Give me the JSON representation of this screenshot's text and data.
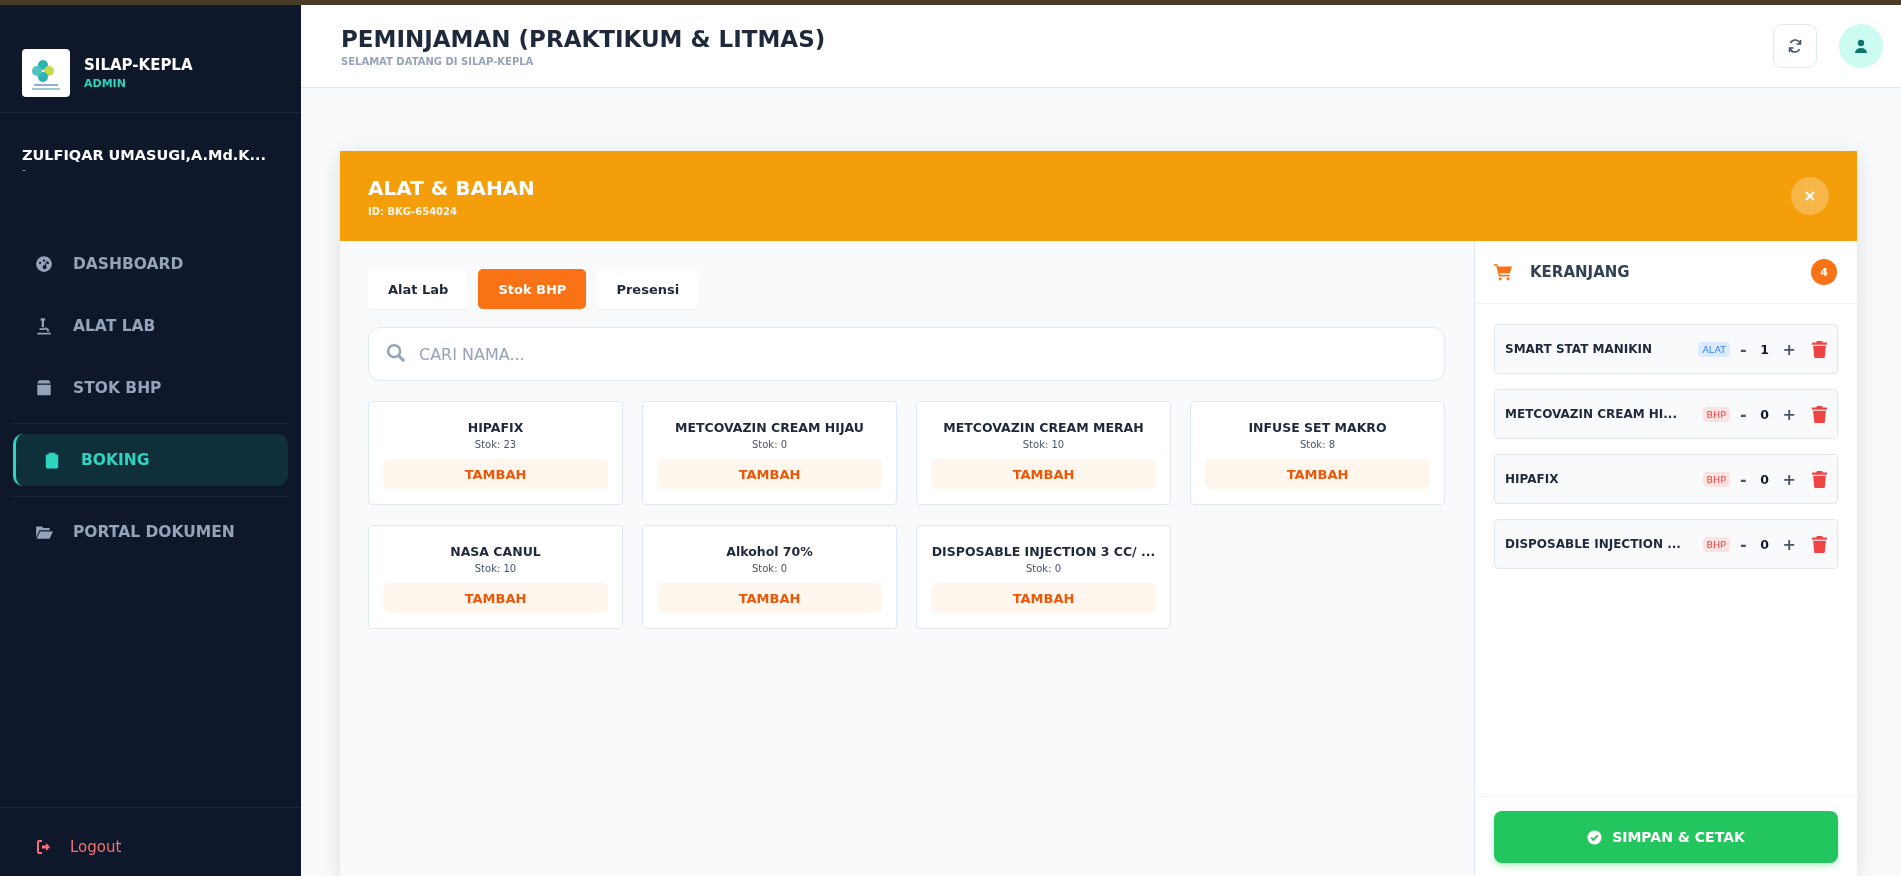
{
  "sidebar": {
    "app_name": "SILAP-KEPLA",
    "role": "ADMIN",
    "user_name": "ZULFIQAR UMASUGI,A.Md.K...",
    "user_sub": "-",
    "items": [
      {
        "label": "DASHBOARD",
        "selected": false
      },
      {
        "label": "ALAT LAB",
        "selected": false
      },
      {
        "label": "STOK BHP",
        "selected": false
      },
      {
        "label": "BOKING",
        "selected": true
      },
      {
        "label": "PORTAL DOKUMEN",
        "selected": false
      }
    ],
    "logout": "Logout"
  },
  "header": {
    "title": "PEMINJAMAN (PRAKTIKUM & LITMAS)",
    "subtitle": "SELAMAT DATANG DI SILAP-KEPLA"
  },
  "modal": {
    "title": "ALAT & BAHAN",
    "id": "ID: BKG-654024",
    "categories": [
      {
        "label": "Alat Lab",
        "selected": false
      },
      {
        "label": "Stok BHP",
        "selected": true
      },
      {
        "label": "Presensi",
        "selected": false
      }
    ],
    "search": {
      "placeholder": "CARI NAMA..."
    },
    "products": [
      {
        "name": "HIPAFIX",
        "stock": "Stok: 23",
        "action": "TAMBAH"
      },
      {
        "name": "METCOVAZIN CREAM HIJAU",
        "stock": "Stok: 0",
        "action": "TAMBAH"
      },
      {
        "name": "METCOVAZIN CREAM MERAH",
        "stock": "Stok: 10",
        "action": "TAMBAH"
      },
      {
        "name": "INFUSE SET MAKRO",
        "stock": "Stok: 8",
        "action": "TAMBAH"
      },
      {
        "name": "NASA CANUL",
        "stock": "Stok: 10",
        "action": "TAMBAH"
      },
      {
        "name": "Alkohol 70%",
        "stock": "Stok: 0",
        "action": "TAMBAH"
      },
      {
        "name": "DISPOSABLE INJECTION 3 CC/ ...",
        "stock": "Stok: 0",
        "action": "TAMBAH"
      }
    ],
    "cart": {
      "title": "KERANJANG",
      "count": "4",
      "items": [
        {
          "name": "SMART STAT MANIKIN",
          "tag": "ALAT",
          "kind": "alat",
          "qty": "1",
          "minus": "-",
          "plus": "+"
        },
        {
          "name": "METCOVAZIN CREAM HI...",
          "tag": "BHP",
          "kind": "bhp",
          "qty": "0",
          "minus": "-",
          "plus": "+"
        },
        {
          "name": "HIPAFIX",
          "tag": "BHP",
          "kind": "bhp",
          "qty": "0",
          "minus": "-",
          "plus": "+"
        },
        {
          "name": "DISPOSABLE INJECTION ...",
          "tag": "BHP",
          "kind": "bhp",
          "qty": "0",
          "minus": "-",
          "plus": "+"
        }
      ],
      "save": "SIMPAN & CETAK"
    }
  }
}
